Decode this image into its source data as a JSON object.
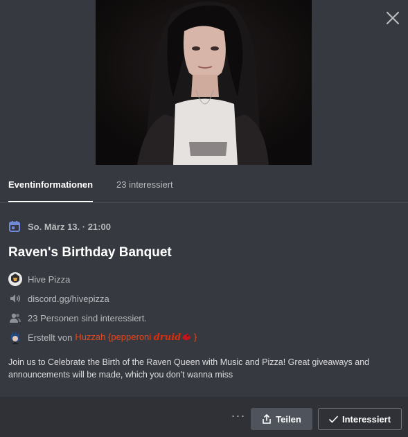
{
  "tabs": {
    "event_info": "Eventinformationen",
    "interested": "23 interessiert"
  },
  "event": {
    "date": "So. März 13. · 21:00",
    "title": "Raven's Birthday Banquet",
    "server": "Hive Pizza",
    "location": "discord.gg/hivepizza",
    "interested_count": "23 Personen sind interessiert.",
    "created_by_label": "Erstellt von",
    "creator_name_prefix": "Huzzah {pepperoni ",
    "creator_name_stylized": "druid",
    "creator_name_suffix": " }",
    "description": "Join us to Celebrate the Birth of the Raven Queen with Music and Pizza! Great giveaways and announcements will be made, which you don't wanna miss"
  },
  "footer": {
    "more": "···",
    "share_label": "Teilen",
    "interested_label": "Interessiert"
  },
  "colors": {
    "background": "#36393f",
    "footer": "#2f3136",
    "accent_calendar": "#7289da",
    "creator_name": "#e8471c"
  },
  "icons": {
    "close": "close-icon",
    "calendar": "calendar-icon",
    "server": "server-avatar",
    "location": "speaker-icon",
    "people": "people-icon",
    "creator": "creator-avatar",
    "share": "share-icon",
    "check": "check-icon"
  }
}
